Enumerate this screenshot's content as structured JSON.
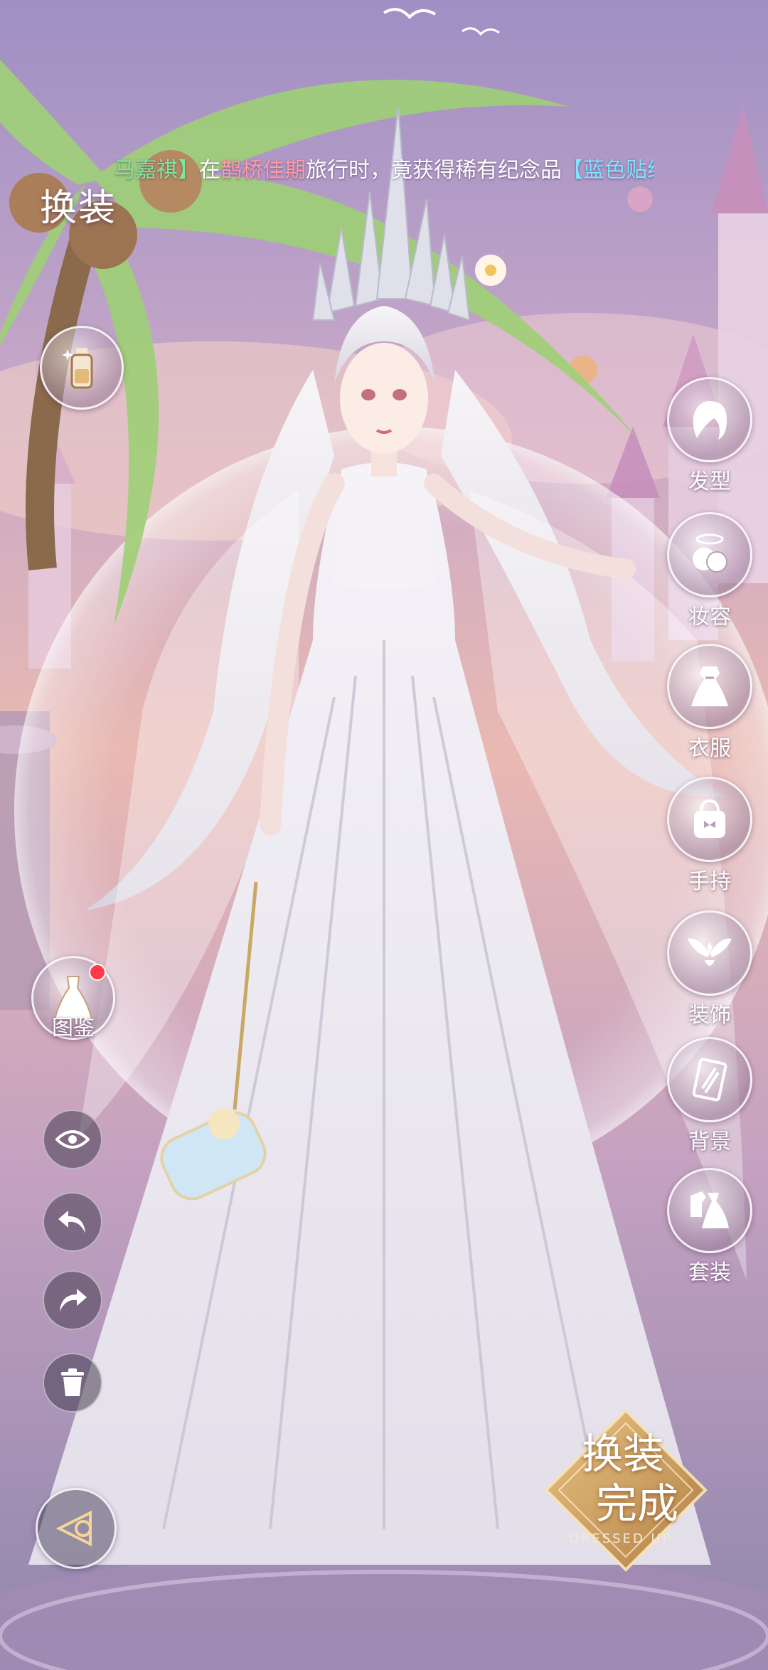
{
  "marquee": {
    "player_name": "马嘉祺】",
    "text_1": "在",
    "location": "鹊桥佳期",
    "text_2": "旅行时，竟获得稀有纪念品",
    "item": "【蓝色贴纸",
    "colors": {
      "name": "#7ee89a",
      "location": "#ff9aa8",
      "item": "#7fe3ff"
    }
  },
  "header": {
    "title": "换装"
  },
  "left_tools": {
    "potion": {
      "icon": "potion-bottle-icon"
    },
    "catalog": {
      "label": "图鉴",
      "icon": "dress-icon",
      "has_notification": true
    },
    "view": {
      "icon": "eye-icon"
    },
    "undo": {
      "icon": "undo-icon"
    },
    "redo": {
      "icon": "redo-icon"
    },
    "delete": {
      "icon": "trash-icon"
    },
    "camera": {
      "icon": "camera-triangle-icon"
    }
  },
  "categories": [
    {
      "id": "hair",
      "label": "发型",
      "icon": "hair-icon"
    },
    {
      "id": "makeup",
      "label": "妆容",
      "icon": "makeup-icon"
    },
    {
      "id": "clothes",
      "label": "衣服",
      "icon": "dress-icon"
    },
    {
      "id": "handheld",
      "label": "手持",
      "icon": "bag-icon"
    },
    {
      "id": "accessories",
      "label": "装饰",
      "icon": "wings-icon"
    },
    {
      "id": "background",
      "label": "背景",
      "icon": "background-icon"
    },
    {
      "id": "suits",
      "label": "套装",
      "icon": "outfit-set-icon"
    }
  ],
  "done_button": {
    "line1": "换装",
    "line2": "完成",
    "sub": "DRESSED UP"
  }
}
